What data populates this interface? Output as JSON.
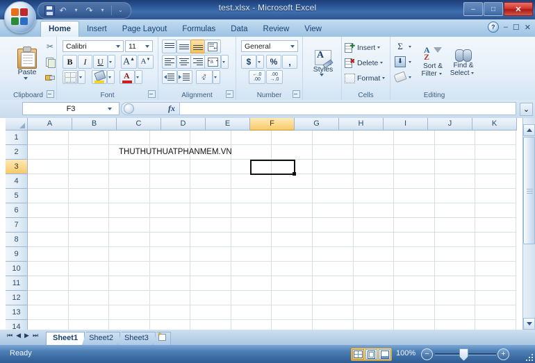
{
  "window": {
    "title": "test.xlsx - Microsoft Excel",
    "minimize": "–",
    "maximize": "□",
    "close": "✕"
  },
  "quick_access": {
    "save": "save-icon",
    "undo": "↶",
    "redo": "↷",
    "customize": "⌄"
  },
  "office_button": "office-orb",
  "ribbon": {
    "tabs": [
      {
        "label": "Home",
        "active": true
      },
      {
        "label": "Insert",
        "active": false
      },
      {
        "label": "Page Layout",
        "active": false
      },
      {
        "label": "Formulas",
        "active": false
      },
      {
        "label": "Data",
        "active": false
      },
      {
        "label": "Review",
        "active": false
      },
      {
        "label": "View",
        "active": false
      }
    ],
    "help": "?",
    "ribbon_minimize": "–",
    "ribbon_restore": "☐",
    "ribbon_close": "✕",
    "groups": {
      "clipboard": {
        "label": "Clipboard",
        "paste": "Paste",
        "cut": "✂",
        "copy": "copy-icon",
        "format_painter": "format-painter-icon"
      },
      "font": {
        "label": "Font",
        "font_name": "Calibri",
        "font_size": "11",
        "bold": "B",
        "italic": "I",
        "underline": "U",
        "grow_font": "A",
        "shrink_font": "A",
        "borders": "borders-icon",
        "fill_color": "fill-color-icon",
        "font_color": "A"
      },
      "alignment": {
        "label": "Alignment",
        "align_top": "align-top-icon",
        "align_middle": "align-middle-icon",
        "align_bottom": "align-bottom-icon",
        "wrap_text": "wrap-text-icon",
        "align_left": "align-left-icon",
        "align_center": "align-center-icon",
        "align_right": "align-right-icon",
        "merge_center": "merge-center-icon",
        "decrease_indent": "decrease-indent-icon",
        "increase_indent": "increase-indent-icon",
        "orientation": "orientation-icon"
      },
      "number": {
        "label": "Number",
        "format": "General",
        "accounting": "$",
        "percent": "%",
        "comma": ",",
        "increase_decimal": ".00",
        "decrease_decimal": ".00"
      },
      "styles": {
        "label": "",
        "button": "Styles"
      },
      "cells": {
        "label": "Cells",
        "items": [
          "Insert",
          "Delete",
          "Format"
        ]
      },
      "editing": {
        "label": "Editing",
        "autosum": "Σ",
        "fill": "fill-down-icon",
        "clear": "clear-icon",
        "sort_filter_line1": "Sort &",
        "sort_filter_line2": "Filter",
        "find_select_line1": "Find &",
        "find_select_line2": "Select"
      }
    }
  },
  "formula_bar": {
    "name_box": "F3",
    "fx_label": "fx",
    "formula_value": "",
    "expand": "⌄"
  },
  "grid": {
    "columns": [
      "A",
      "B",
      "C",
      "D",
      "E",
      "F",
      "G",
      "H",
      "I",
      "J",
      "K"
    ],
    "selected_column": "F",
    "rows": [
      "1",
      "2",
      "3",
      "4",
      "5",
      "6",
      "7",
      "8",
      "9",
      "10",
      "11",
      "12",
      "13",
      "14"
    ],
    "selected_row": "3",
    "cells": [
      {
        "row": 2,
        "col": 2,
        "value": "THUTHUTHUATPHANMEM.VN"
      }
    ],
    "active_cell": "F3",
    "select_all_corner": "select-all-icon"
  },
  "sheet_tabs": {
    "nav_first": "⏮",
    "nav_prev": "◀",
    "nav_next": "▶",
    "nav_last": "⏭",
    "tabs": [
      {
        "label": "Sheet1",
        "active": true
      },
      {
        "label": "Sheet2",
        "active": false
      },
      {
        "label": "Sheet3",
        "active": false
      }
    ],
    "new_sheet": "➕"
  },
  "status_bar": {
    "status": "Ready",
    "view_normal": "normal-view-icon",
    "view_page_layout": "page-layout-view-icon",
    "view_page_break": "page-break-view-icon",
    "zoom_level": "100%",
    "zoom_out": "−",
    "zoom_in": "+"
  },
  "colors": {
    "accent": "#2e5b93",
    "selection": "#f7c96a",
    "close_button": "#d6352c"
  }
}
